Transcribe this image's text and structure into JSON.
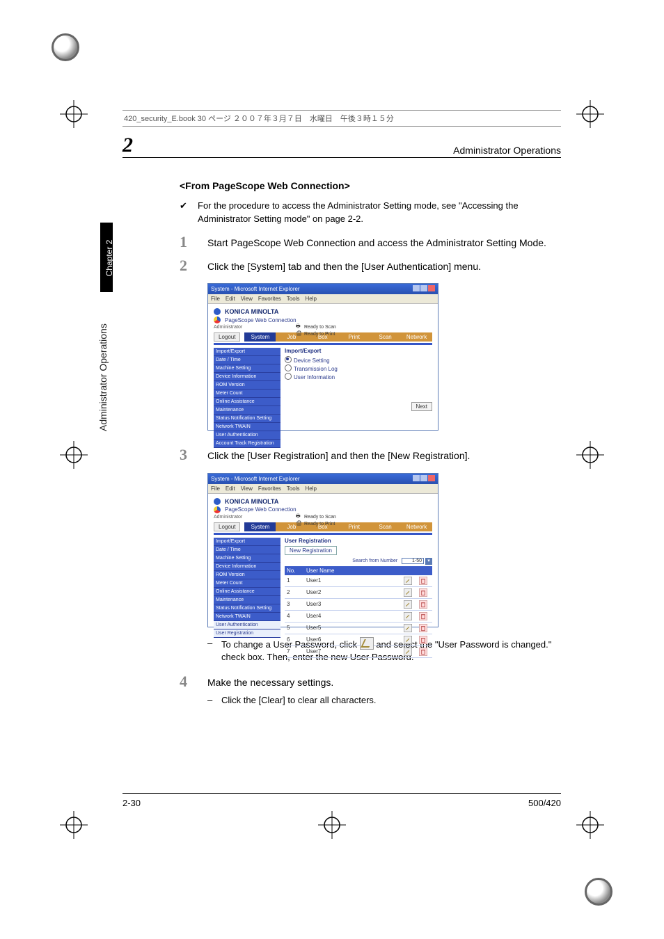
{
  "print_header": "420_security_E.book  30 ページ  ２００７年３月７日　水曜日　午後３時１５分",
  "chapter_number": "2",
  "header_right": "Administrator Operations",
  "side_tab_black": "Chapter 2",
  "side_tab_grey": "Administrator Operations",
  "section_title": "<From PageScope Web Connection>",
  "check_text": "For the procedure to access the Administrator Setting mode, see \"Accessing the Administrator Setting mode\" on page 2-2.",
  "steps": {
    "s1_num": "1",
    "s1_txt": "Start PageScope Web Connection and access the Administrator Setting Mode.",
    "s2_num": "2",
    "s2_txt": "Click the [System] tab and then the [User Authentication] menu.",
    "s3_num": "3",
    "s3_txt": "Click the [User Registration] and then the [New Registration].",
    "s3_sub": "To change a User Password, click        and select the \"User Password is changed.\" check box. Then, enter the new User Password.",
    "s4_num": "4",
    "s4_txt": "Make the necessary settings.",
    "s4_sub": "Click the [Clear] to clear all characters."
  },
  "footer_left": "2-30",
  "footer_right": "500/420",
  "ie": {
    "title": "System - Microsoft Internet Explorer",
    "menus": [
      "File",
      "Edit",
      "View",
      "Favorites",
      "Tools",
      "Help"
    ],
    "brand": "KONICA MINOLTA",
    "pswc": "PageScope Web Connection",
    "admin": "Administrator",
    "status1": "Ready to Scan",
    "status2": "Ready to Print",
    "logout": "Logout",
    "tabs": {
      "system": "System",
      "job": "Job",
      "box": "Box",
      "print": "Print",
      "scan": "Scan",
      "network": "Network"
    }
  },
  "shot1": {
    "side": [
      "Import/Export",
      "Date / Time",
      "Machine Setting",
      "Device Information",
      "ROM Version",
      "Meter Count",
      "Online Assistance",
      "Maintenance",
      "Status Notification Setting",
      "Network TWAIN",
      "User Authentication",
      "Account Track Registration"
    ],
    "main_heading": "Import/Export",
    "radios": [
      "Device Setting",
      "Transmission Log",
      "User Information"
    ],
    "next": "Next"
  },
  "shot2": {
    "side": [
      "Import/Export",
      "Date / Time",
      "Machine Setting",
      "Device Information",
      "ROM Version",
      "Meter Count",
      "Online Assistance",
      "Maintenance",
      "Status Notification Setting",
      "Network TWAIN",
      "User Authentication",
      "User Registration"
    ],
    "heading": "User Registration",
    "new_registration": "New Registration",
    "search_label": "Search from Number",
    "search_value": "1-50",
    "th_no": "No.",
    "th_user": "User Name",
    "rows": [
      {
        "no": "1",
        "name": "User1"
      },
      {
        "no": "2",
        "name": "User2"
      },
      {
        "no": "3",
        "name": "User3"
      },
      {
        "no": "4",
        "name": "User4"
      },
      {
        "no": "5",
        "name": "User5"
      },
      {
        "no": "6",
        "name": "User6"
      },
      {
        "no": "7",
        "name": "User7"
      }
    ]
  }
}
